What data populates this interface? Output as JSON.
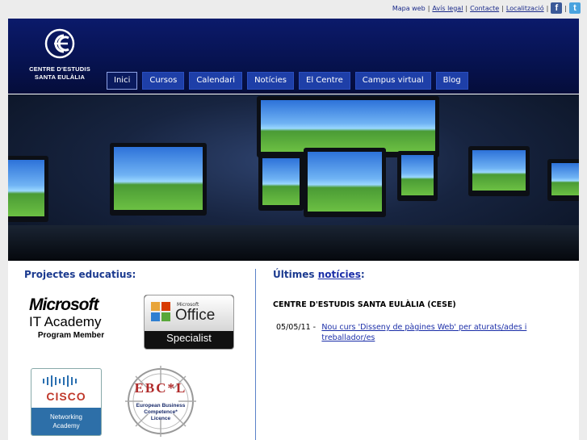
{
  "top_links": {
    "mapa_web": "Mapa web",
    "avis_legal": "Avís legal",
    "contacte": "Contacte",
    "localitzacio": "Localització"
  },
  "logo": {
    "line1": "CENTRE D'ESTUDIS",
    "line2": "SANTA EULÀLIA"
  },
  "nav": [
    "Inici",
    "Cursos",
    "Calendari",
    "Notícies",
    "El Centre",
    "Campus virtual",
    "Blog"
  ],
  "left": {
    "heading": "Projectes educatius:"
  },
  "right": {
    "heading_prefix": "Últimes",
    "heading_link": "notícies",
    "heading_suffix": ":",
    "section_title": "CENTRE D'ESTUDIS SANTA EULÀLIA (CESE)",
    "news": [
      {
        "date": "05/05/11 -",
        "title": "Nou curs 'Disseny de pàgines Web' per aturats/ades i treballador/es"
      }
    ]
  },
  "badges": {
    "microsoft": {
      "word": "Microsoft",
      "line2": "IT Academy",
      "line3": "Program Member"
    },
    "office": {
      "ms": "Microsoft",
      "word": "Office",
      "line2": "Specialist"
    },
    "cisco": {
      "word": "CISCO",
      "line2": "Networking",
      "line3": "Academy"
    },
    "ebcl": {
      "word": "EBC*L",
      "line2": "European Business",
      "line3": "Competence*",
      "line4": "Licence"
    }
  },
  "colors": {
    "header": "#0b1a6b",
    "nav": "#1e3fa8",
    "link": "#1b2ea8",
    "heading": "#1b3a8f"
  }
}
